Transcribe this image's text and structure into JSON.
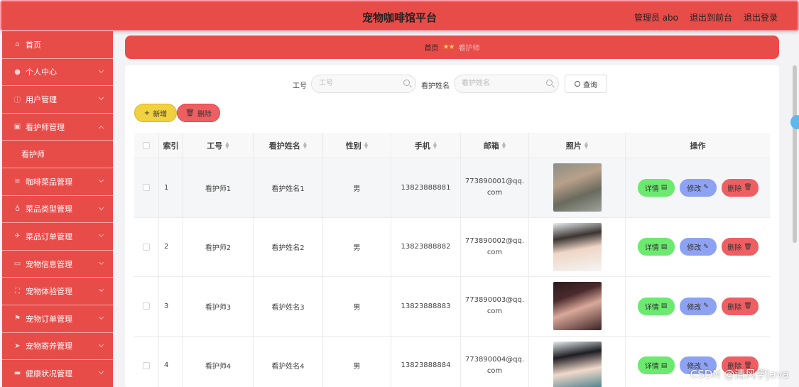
{
  "header": {
    "title": "宠物咖啡馆平台",
    "admin": "管理员 abo",
    "to_front": "退出到前台",
    "logout": "退出登录"
  },
  "sidebar": {
    "items": [
      {
        "label": "首页",
        "icon": "home-icon",
        "expand": false
      },
      {
        "label": "个人中心",
        "icon": "user-icon",
        "expand": true
      },
      {
        "label": "用户管理",
        "icon": "info-icon",
        "expand": true
      },
      {
        "label": "看护师管理",
        "icon": "chart-icon",
        "expand": true
      },
      {
        "label": "看护师",
        "icon": "",
        "expand": false,
        "sub": true
      },
      {
        "label": "咖啡菜品管理",
        "icon": "list-icon",
        "expand": true
      },
      {
        "label": "菜品类型管理",
        "icon": "mic-icon",
        "expand": true
      },
      {
        "label": "菜品订单管理",
        "icon": "plane-icon",
        "expand": true
      },
      {
        "label": "宠物信息管理",
        "icon": "chat-icon",
        "expand": true
      },
      {
        "label": "宠物体验管理",
        "icon": "fullscreen-icon",
        "expand": true
      },
      {
        "label": "宠物订单管理",
        "icon": "flag-icon",
        "expand": true
      },
      {
        "label": "宠物寄养管理",
        "icon": "send-icon",
        "expand": true
      },
      {
        "label": "健康状况管理",
        "icon": "monitor-icon",
        "expand": true
      }
    ]
  },
  "breadcrumb": {
    "home": "首页",
    "current": "看护师"
  },
  "search": {
    "label1": "工号",
    "placeholder1": "工号",
    "label2": "看护姓名",
    "placeholder2": "看护姓名",
    "button": "查询"
  },
  "actions": {
    "add": "新增",
    "delete": "删除"
  },
  "table": {
    "headers": [
      "索引",
      "工号",
      "看护姓名",
      "性别",
      "手机",
      "邮箱",
      "照片",
      "操作"
    ],
    "rows": [
      {
        "index": "1",
        "code": "看护师1",
        "name": "看护姓名1",
        "gender": "男",
        "phone": "13823888881",
        "email": "773890001@qq.com"
      },
      {
        "index": "2",
        "code": "看护师2",
        "name": "看护姓名2",
        "gender": "男",
        "phone": "13823888882",
        "email": "773890002@qq.com"
      },
      {
        "index": "3",
        "code": "看护师3",
        "name": "看护姓名3",
        "gender": "男",
        "phone": "13823888883",
        "email": "773890003@qq.com"
      },
      {
        "index": "4",
        "code": "看护师4",
        "name": "看护姓名4",
        "gender": "男",
        "phone": "13823888884",
        "email": "773890004@qq.com"
      }
    ],
    "op_detail": "详情",
    "op_edit": "修改",
    "op_delete": "删除"
  },
  "watermark": "CSDN @清风学Java"
}
